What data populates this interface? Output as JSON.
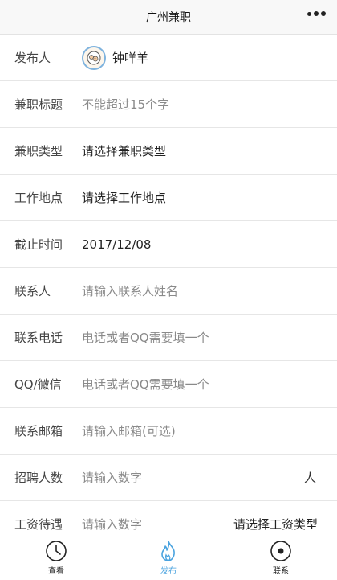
{
  "navbar": {
    "title": "广州兼职"
  },
  "form": {
    "publisher": {
      "label": "发布人",
      "name": "钟咩羊"
    },
    "job_title": {
      "label": "兼职标题",
      "placeholder": "不能超过15个字"
    },
    "job_type": {
      "label": "兼职类型",
      "value": "请选择兼职类型"
    },
    "location": {
      "label": "工作地点",
      "value": "请选择工作地点"
    },
    "deadline": {
      "label": "截止时间",
      "value": "2017/12/08"
    },
    "contact": {
      "label": "联系人",
      "placeholder": "请输入联系人姓名"
    },
    "phone": {
      "label": "联系电话",
      "placeholder": "电话或者QQ需要填一个"
    },
    "qq": {
      "label": "QQ/微信",
      "placeholder": "电话或者QQ需要填一个"
    },
    "email": {
      "label": "联系邮箱",
      "placeholder": "请输入邮箱(可选)"
    },
    "headcount": {
      "label": "招聘人数",
      "placeholder": "请输入数字",
      "unit": "人"
    },
    "salary": {
      "label": "工资待遇",
      "placeholder": "请输入数字",
      "type_select": "请选择工资类型"
    }
  },
  "tabbar": {
    "tabs": [
      {
        "label": "查看",
        "icon": "clock-icon"
      },
      {
        "label": "发布",
        "icon": "flame-icon"
      },
      {
        "label": "联系",
        "icon": "target-icon"
      }
    ],
    "active_color": "#4aa3df"
  }
}
